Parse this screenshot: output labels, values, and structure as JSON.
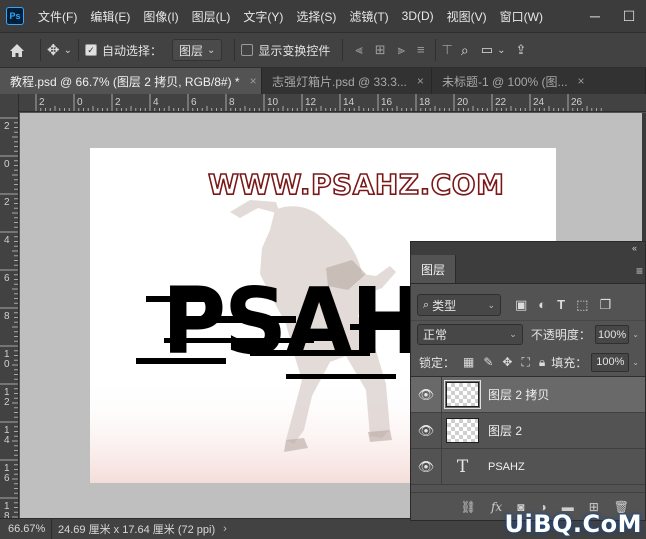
{
  "app": {
    "logo": "Ps",
    "menu": [
      "文件(F)",
      "编辑(E)",
      "图像(I)",
      "图层(L)",
      "文字(Y)",
      "选择(S)",
      "滤镜(T)",
      "3D(D)",
      "视图(V)",
      "窗口(W)"
    ],
    "window_controls": [
      "minimize-icon",
      "maximize-icon",
      "close-icon"
    ]
  },
  "options_bar": {
    "auto_select_label": "自动选择：",
    "auto_select_checked": true,
    "auto_select_target": "图层",
    "show_transform_label": "显示变换控件",
    "show_transform_checked": false
  },
  "tabs": [
    {
      "label": "教程.psd @ 66.7% (图层 2 拷贝, RGB/8#) *",
      "active": true
    },
    {
      "label": "志强灯箱片.psd @ 33.3...",
      "active": false
    },
    {
      "label": "未标题-1 @ 100% (图...",
      "active": false
    }
  ],
  "rulers": {
    "h_labels": [
      "2",
      "0",
      "2",
      "4",
      "6",
      "8",
      "10",
      "12",
      "14",
      "16",
      "18",
      "20",
      "22",
      "24",
      "26"
    ],
    "v_labels": [
      "2",
      "0",
      "2",
      "4",
      "6",
      "8",
      "10",
      "12",
      "14",
      "16",
      "18"
    ]
  },
  "canvas": {
    "url_text": "WWW.PSAHZ.COM",
    "big_text": "PSAHZ",
    "accent_color": "#7a1717"
  },
  "status": {
    "zoom": "66.67%",
    "doc_info": "24.69 厘米 x 17.64 厘米 (72 ppi)",
    "arrow": "›"
  },
  "layers_panel": {
    "tab_label": "图层",
    "kind_filter": "类型",
    "blend_mode": "正常",
    "opacity_label": "不透明度：",
    "opacity_value": "100%",
    "lock_label": "锁定：",
    "fill_label": "填充：",
    "fill_value": "100%",
    "layers": [
      {
        "name": "图层 2 拷贝",
        "type": "pixel",
        "selected": true
      },
      {
        "name": "图层 2",
        "type": "pixel",
        "selected": false
      },
      {
        "name": "PSAHZ",
        "type": "text",
        "selected": false
      }
    ],
    "text_glyph": "T",
    "footer_icons": [
      "link-icon",
      "fx-icon",
      "mask-icon",
      "adjustment-icon",
      "folder-icon",
      "new-layer-icon",
      "trash-icon"
    ]
  },
  "watermark": "UiBQ.CoM"
}
